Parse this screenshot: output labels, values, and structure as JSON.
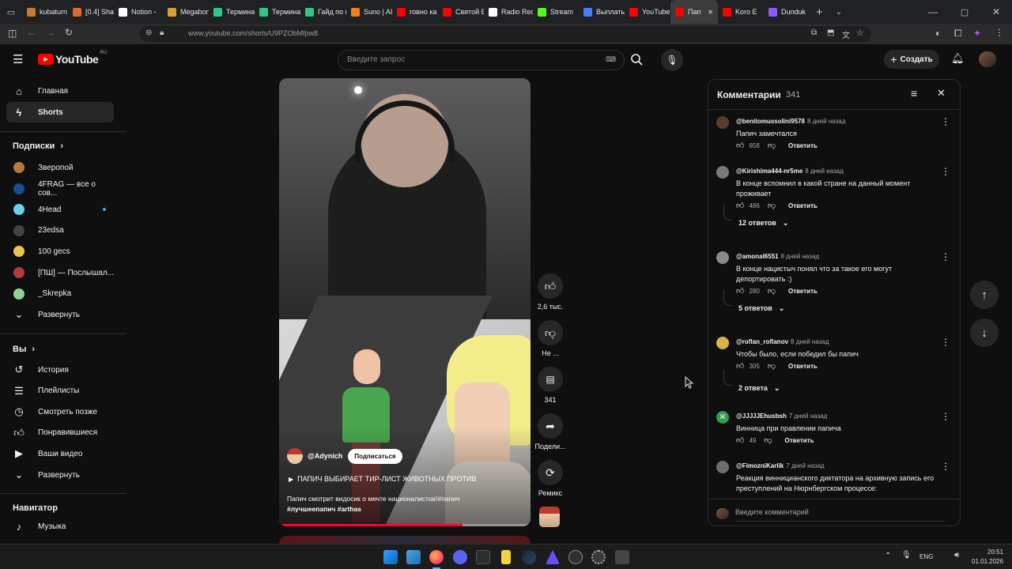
{
  "browser": {
    "tabs": [
      {
        "label": "kubaturn",
        "color": "#c77b2e"
      },
      {
        "label": "[0.4] Shar",
        "color": "#e06c2c"
      },
      {
        "label": "Notion -",
        "color": "#ffffff"
      },
      {
        "label": "Megabon",
        "color": "#d4a23a"
      },
      {
        "label": "Термина",
        "color": "#31c48d"
      },
      {
        "label": "Термина",
        "color": "#31c48d"
      },
      {
        "label": "Гайд по п",
        "color": "#31c48d"
      },
      {
        "label": "Suno | AI",
        "color": "#ff7a1a"
      },
      {
        "label": "говно ка",
        "color": "#ff0000"
      },
      {
        "label": "Святой В",
        "color": "#ff0000"
      },
      {
        "label": "Radio Rec",
        "color": "#ffffff"
      },
      {
        "label": "Stream",
        "color": "#53fc18"
      },
      {
        "label": "Выплаты",
        "color": "#4a7bff"
      },
      {
        "label": "YouTube",
        "color": "#ff0000"
      },
      {
        "label": "Пап",
        "color": "#ff0000",
        "active": true
      },
      {
        "label": "Koro E",
        "color": "#ff0000"
      },
      {
        "label": "Dunduk",
        "color": "#8b5cf6"
      }
    ],
    "url": "www.youtube.com/shorts/U9PZObMfpw8"
  },
  "header": {
    "logo_text": "YouTube",
    "logo_region": "RU",
    "search_placeholder": "Введите запрос",
    "create_label": "Создать"
  },
  "sidebar": {
    "main": [
      {
        "label": "Главная",
        "icon": "home-icon"
      },
      {
        "label": "Shorts",
        "icon": "shorts-icon",
        "active": true
      }
    ],
    "subs_title": "Подписки",
    "subs": [
      {
        "label": "Зверопой",
        "color": "#b57b3e"
      },
      {
        "label": "4FRAG — все о сов...",
        "color": "#1a4d8f"
      },
      {
        "label": "4Head",
        "color": "#6ad2e8",
        "dot": true
      },
      {
        "label": "23edsa",
        "color": "#444444"
      },
      {
        "label": "100 gecs",
        "color": "#e8c54a"
      },
      {
        "label": "[ПШ] — Послышал...",
        "color": "#b23b3b"
      },
      {
        "label": "_Skrepka",
        "color": "#8fd18f"
      }
    ],
    "subs_expand": "Развернуть",
    "you_title": "Вы",
    "you": [
      {
        "label": "История",
        "icon": "history-icon"
      },
      {
        "label": "Плейлисты",
        "icon": "playlists-icon"
      },
      {
        "label": "Смотреть позже",
        "icon": "watch-later-icon"
      },
      {
        "label": "Понравившиеся",
        "icon": "thumb-up-icon"
      },
      {
        "label": "Ваши видео",
        "icon": "your-videos-icon"
      },
      {
        "label": "Развернуть",
        "icon": "chevron-down-icon"
      }
    ],
    "nav_title": "Навигатор",
    "nav": [
      {
        "label": "Музыка",
        "icon": "music-icon"
      }
    ]
  },
  "short": {
    "channel": "@Adynich",
    "subscribe": "Подписаться",
    "title": "ПАПИЧ ВЫБИРАЕТ ТИР-ЛИСТ ЖИВОТНЫХ ПРОТИВ",
    "description": "Папич смотрит видосик о мечте националистов!#папич",
    "hashtags": "#лучшеепапич #arthas",
    "progress": 0.73,
    "likes": "2,6 тыс.",
    "dislike_label": "Не ...",
    "comments_count": "341",
    "share_label": "Подели...",
    "remix_label": "Ремикс"
  },
  "comments_panel": {
    "title": "Комментарии",
    "count": "341",
    "input_placeholder": "Введите комментарий",
    "items": [
      {
        "author": "@benitomussolini9578",
        "time": "8 дней назад",
        "text": "Папич замечтался",
        "likes": "658",
        "reply": "Ответить",
        "avatar_color": "#5a3e2b"
      },
      {
        "author": "@Kirishima444-nr5me",
        "time": "8 дней назад",
        "text": "В конце вспомнил в какой стране на данный момент проживает",
        "likes": "486",
        "reply": "Ответить",
        "replies": "12 ответов",
        "avatar_color": "#7a7a7a"
      },
      {
        "author": "@amonal6551",
        "time": "8 дней назад",
        "text": "В конце нацистыч понял что за такое его могут депортировать :)",
        "likes": "280",
        "reply": "Ответить",
        "replies": "5 ответов",
        "avatar_color": "#8a8a8a"
      },
      {
        "author": "@roflan_roflanov",
        "time": "8 дней назад",
        "text": "Чтобы было, если победил бы папич",
        "likes": "305",
        "reply": "Ответить",
        "replies": "2 ответа",
        "avatar_color": "#d8b24a"
      },
      {
        "author": "@JJJJJEhusbsh",
        "time": "7 дней назад",
        "text": "Винница при правлении папича",
        "likes": "49",
        "reply": "Ответить",
        "avatar_color": "#2e9e4f",
        "avatar_letter": "Ж"
      },
      {
        "author": "@FimozniKarlik",
        "time": "7 дней назад",
        "text": "Реакция винницианского диктатора на архивную запись его преступлений на Нюрнбергском процессе:",
        "avatar_color": "#6d6d6d"
      }
    ]
  },
  "taskbar": {
    "lang": "ENG",
    "time": "20:51",
    "date": "01.01.2026"
  }
}
